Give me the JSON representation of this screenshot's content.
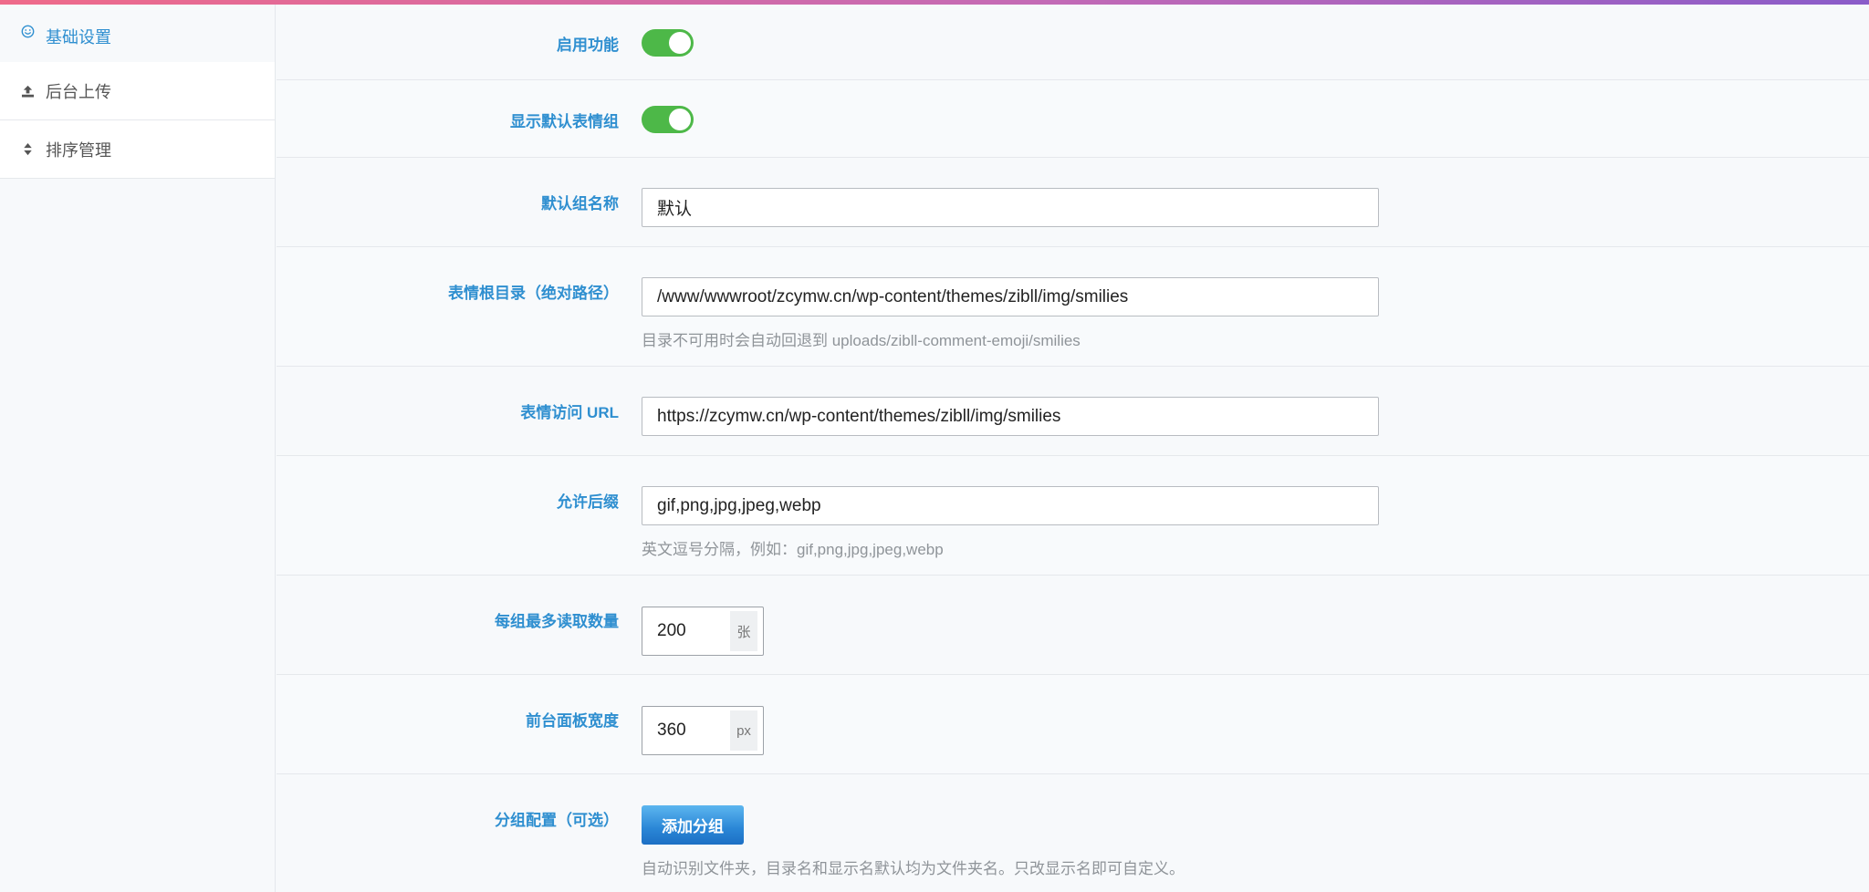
{
  "sidebar": {
    "items": [
      {
        "label": "基础设置",
        "icon": "smiley-icon",
        "active": true
      },
      {
        "label": "后台上传",
        "icon": "upload-icon",
        "active": false
      },
      {
        "label": "排序管理",
        "icon": "sort-icon",
        "active": false
      }
    ]
  },
  "settings": {
    "enable": {
      "label": "启用功能",
      "on": true
    },
    "show_default": {
      "label": "显示默认表情组",
      "on": true
    },
    "default_group_name": {
      "label": "默认组名称",
      "value": "默认"
    },
    "root_dir": {
      "label": "表情根目录（绝对路径）",
      "value": "/www/wwwroot/zcymw.cn/wp-content/themes/zibll/img/smilies",
      "hint": "目录不可用时会自动回退到 uploads/zibll-comment-emoji/smilies"
    },
    "access_url": {
      "label": "表情访问 URL",
      "value": "https://zcymw.cn/wp-content/themes/zibll/img/smilies"
    },
    "allowed_ext": {
      "label": "允许后缀",
      "value": "gif,png,jpg,jpeg,webp",
      "hint": "英文逗号分隔，例如：gif,png,jpg,jpeg,webp"
    },
    "max_per_group": {
      "label": "每组最多读取数量",
      "value": "200",
      "unit": "张"
    },
    "panel_width": {
      "label": "前台面板宽度",
      "value": "360",
      "unit": "px"
    },
    "group_config": {
      "label": "分组配置（可选）",
      "button": "添加分组",
      "hint": "自动识别文件夹，目录名和显示名默认均为文件夹名。只改显示名即可自定义。"
    }
  },
  "colors": {
    "accent": "#2f8fd0",
    "switch_on": "#4db848",
    "top_gradient": [
      "#ef6a8a",
      "#8a5cc9"
    ]
  }
}
